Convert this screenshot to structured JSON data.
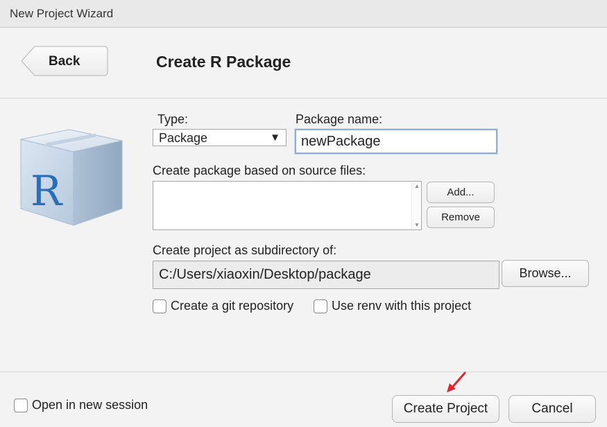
{
  "window": {
    "title": "New Project Wizard"
  },
  "header": {
    "back_label": "Back",
    "page_title": "Create R Package"
  },
  "form": {
    "type_label": "Type:",
    "type_value": "Package",
    "package_name_label": "Package name:",
    "package_name_value": "newPackage",
    "source_files_label": "Create package based on source files:",
    "add_label": "Add...",
    "remove_label": "Remove",
    "subdir_label": "Create project as subdirectory of:",
    "subdir_value": "C:/Users/xiaoxin/Desktop/package",
    "browse_label": "Browse...",
    "git_label": "Create a git repository",
    "renv_label": "Use renv with this project"
  },
  "footer": {
    "new_session_label": "Open in new session",
    "create_label": "Create Project",
    "cancel_label": "Cancel"
  },
  "icons": {
    "package_icon": "r-package-icon",
    "caret": "caret-down-icon",
    "annotation": "red-arrow-icon"
  },
  "colors": {
    "accent_red": "#e0262d",
    "input_focus": "#94aed0",
    "r_logo": "#2a6ebb"
  }
}
